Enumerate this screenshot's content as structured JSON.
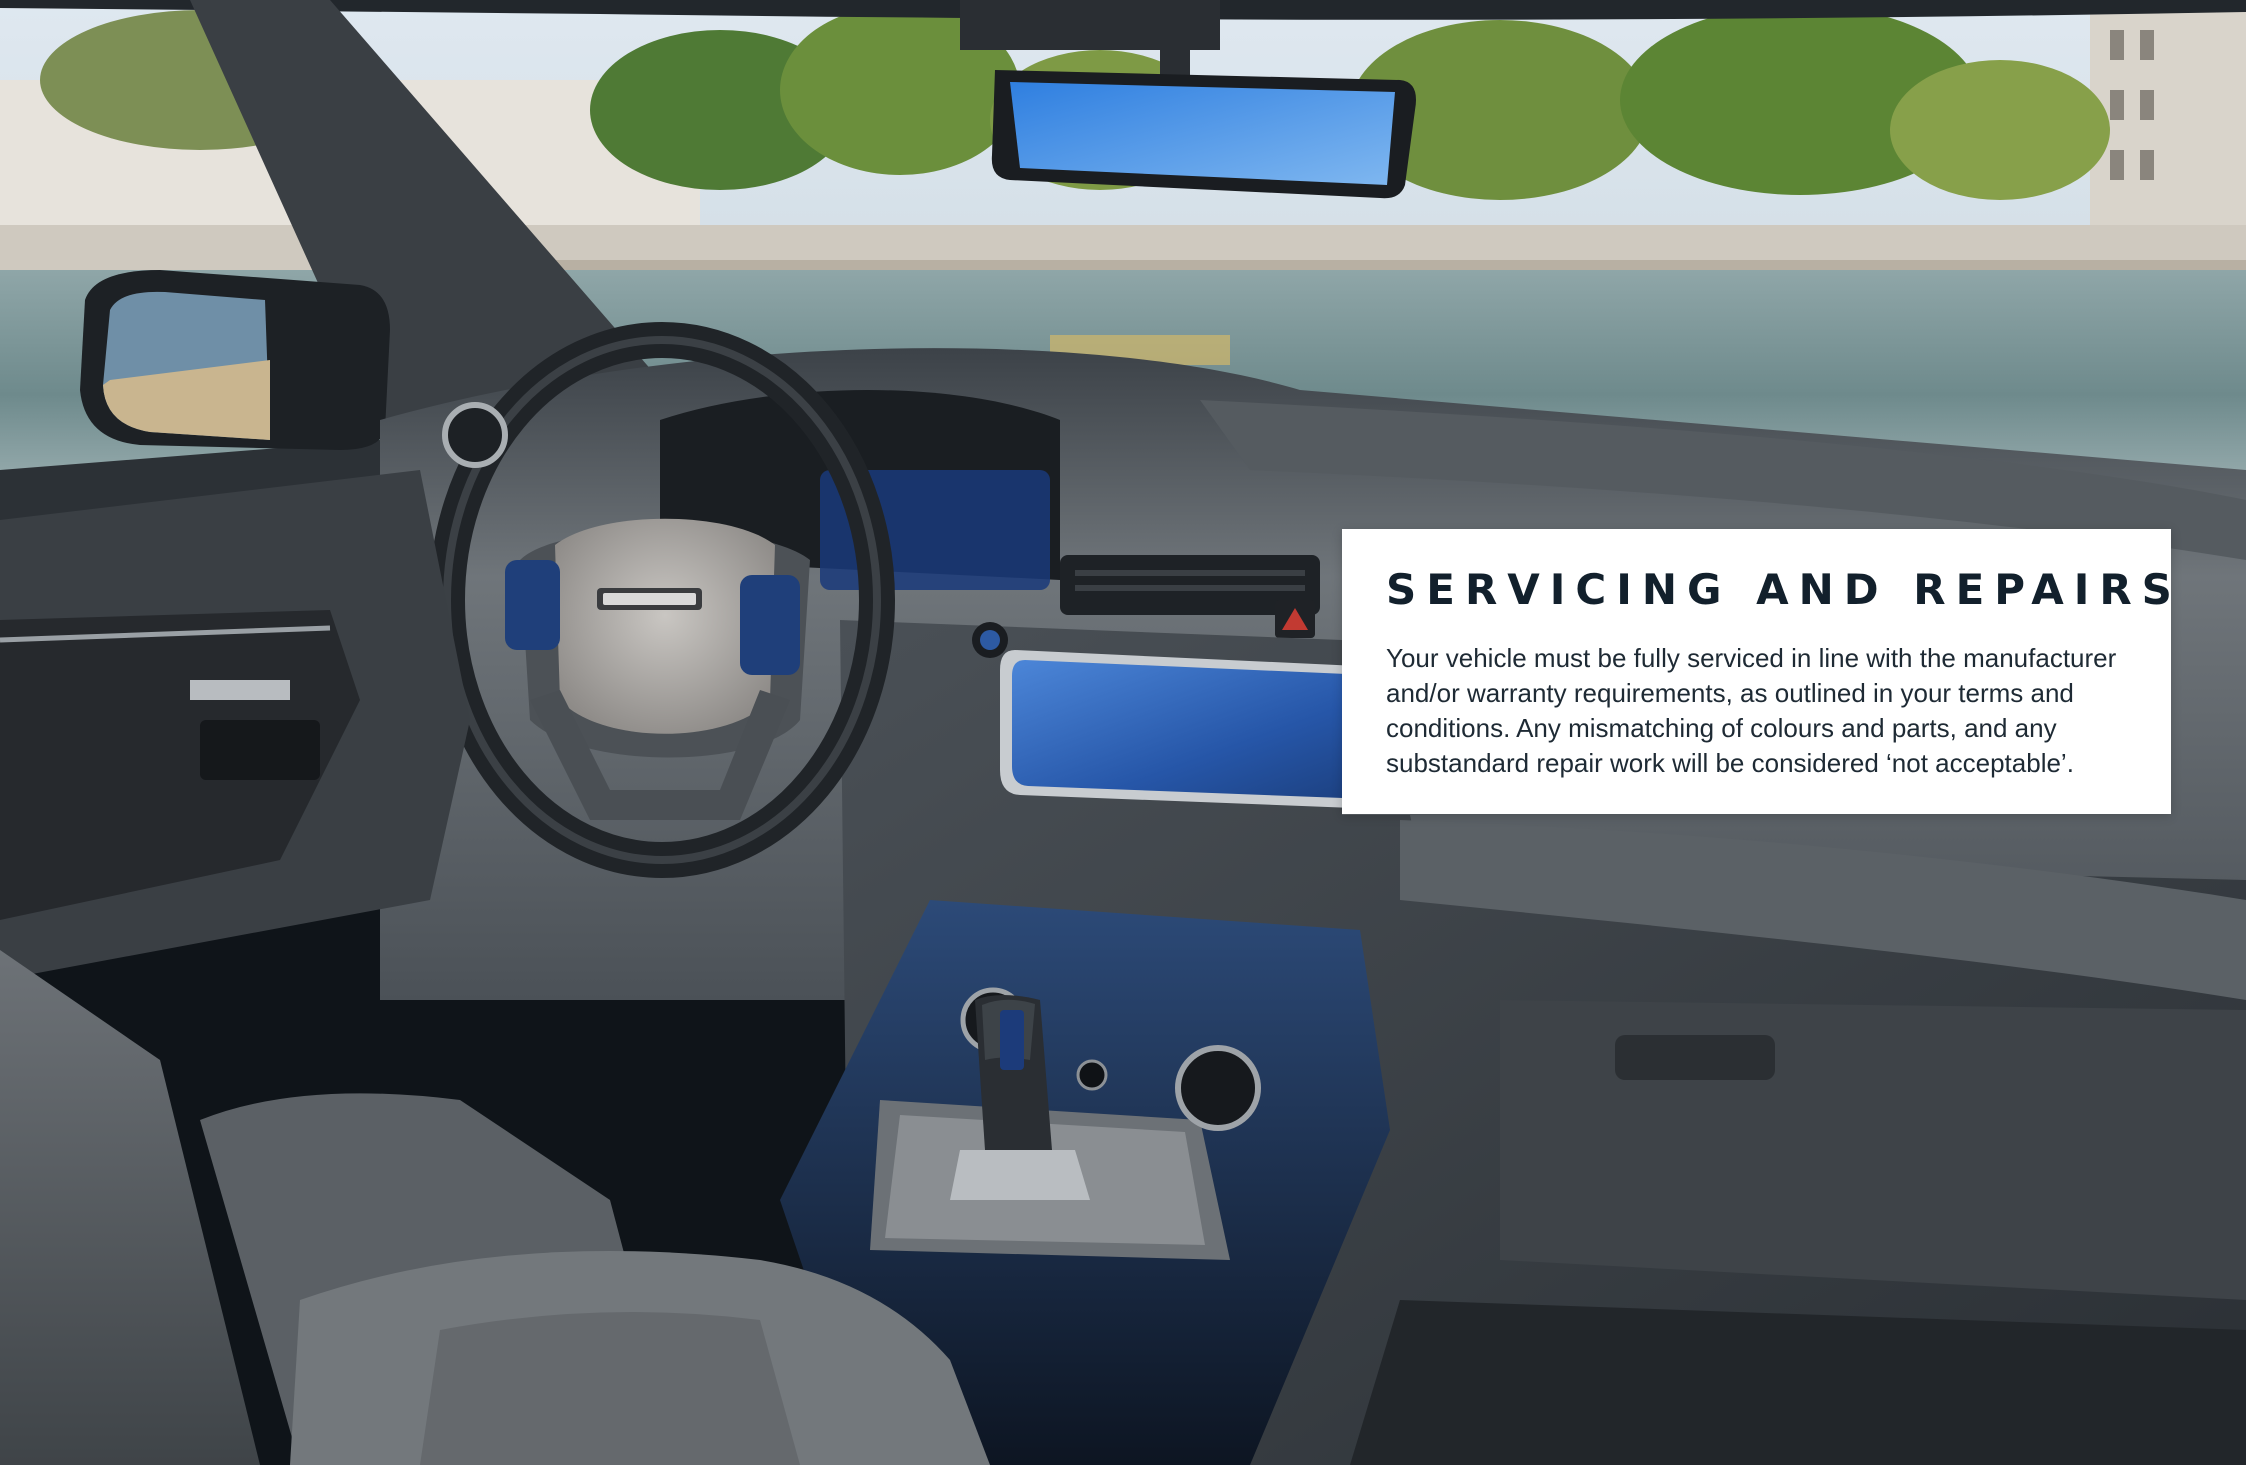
{
  "panel": {
    "title": "SERVICING AND REPAIRS",
    "body": "Your vehicle must be fully serviced in line with the manufacturer and/or warranty requirements, as outlined in your terms and conditions. Any mismatching of colours and parts, and any substandard repair work will be considered ‘not acceptable’."
  },
  "photo": {
    "description_icons": [
      "steering-wheel",
      "rearview-mirror",
      "side-mirror",
      "gear-selector",
      "touchscreen",
      "hazard-button"
    ]
  },
  "colors": {
    "panel_background": "#ffffff",
    "title_color": "#12202c",
    "body_color": "#1e2a34",
    "dashboard_grey": "#6a6f74",
    "screen_blue": "#2f6fd0"
  }
}
